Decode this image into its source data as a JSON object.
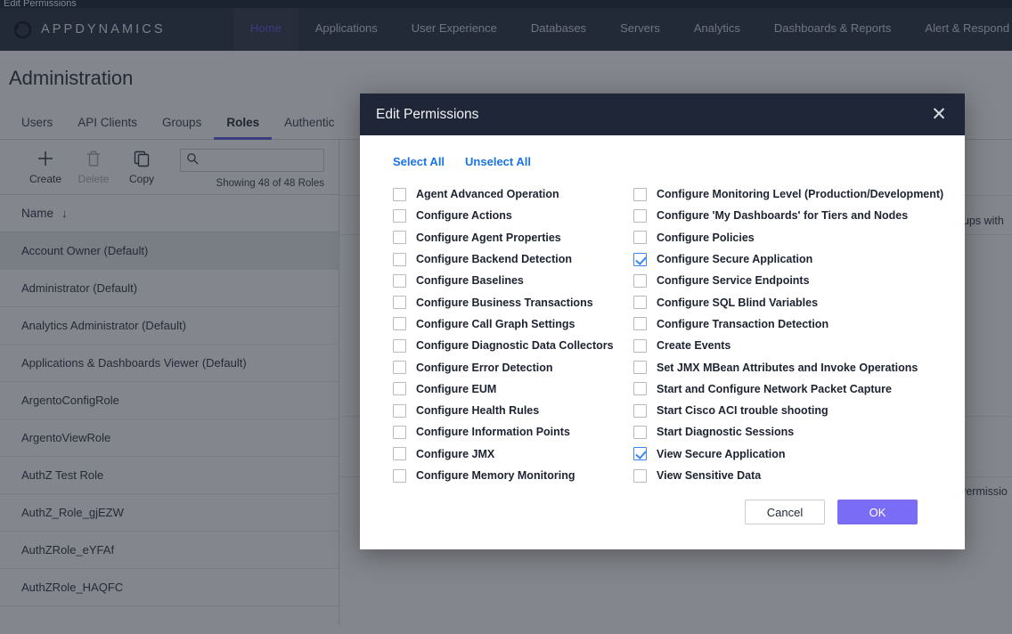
{
  "window": {
    "title": "Edit Permissions"
  },
  "topnav": {
    "brand": "APPDYNAMICS",
    "brand_icon": "appdynamics-logo-icon",
    "items": [
      {
        "label": "Home",
        "active": true
      },
      {
        "label": "Applications",
        "active": false
      },
      {
        "label": "User Experience",
        "active": false
      },
      {
        "label": "Databases",
        "active": false
      },
      {
        "label": "Servers",
        "active": false
      },
      {
        "label": "Analytics",
        "active": false
      },
      {
        "label": "Dashboards & Reports",
        "active": false
      },
      {
        "label": "Alert & Respond",
        "active": false
      }
    ]
  },
  "page": {
    "title": "Administration",
    "tabs": [
      {
        "label": "Users",
        "active": false
      },
      {
        "label": "API Clients",
        "active": false
      },
      {
        "label": "Groups",
        "active": false
      },
      {
        "label": "Roles",
        "active": true
      },
      {
        "label": "Authentic",
        "active": false
      }
    ]
  },
  "toolbar": {
    "create_label": "Create",
    "create_icon": "plus-icon",
    "delete_label": "Delete",
    "delete_icon": "trash-icon",
    "copy_label": "Copy",
    "copy_icon": "copy-icon",
    "search_icon": "search-icon",
    "search_value": "",
    "search_placeholder": "",
    "showing_text": "Showing 48 of 48 Roles"
  },
  "roles_list": {
    "column_header": "Name",
    "sort_icon": "arrow-down-icon",
    "rows": [
      {
        "name": "Account Owner (Default)",
        "selected": true
      },
      {
        "name": "Administrator (Default)",
        "selected": false
      },
      {
        "name": "Analytics Administrator (Default)",
        "selected": false
      },
      {
        "name": "Applications & Dashboards Viewer (Default)",
        "selected": false
      },
      {
        "name": "ArgentoConfigRole",
        "selected": false
      },
      {
        "name": "ArgentoViewRole",
        "selected": false
      },
      {
        "name": "AuthZ Test Role",
        "selected": false
      },
      {
        "name": "AuthZ_Role_gjEZW",
        "selected": false
      },
      {
        "name": "AuthZRole_eYFAf",
        "selected": false
      },
      {
        "name": "AuthZRole_HAQFC",
        "selected": false
      }
    ]
  },
  "detail_pane": {
    "groups_text": "oups with",
    "permissions_text": "Permissio"
  },
  "modal": {
    "title": "Edit Permissions",
    "close_icon": "close-icon",
    "select_all_label": "Select All",
    "unselect_all_label": "Unselect All",
    "permissions_left": [
      {
        "label": "Agent Advanced Operation",
        "checked": false
      },
      {
        "label": "Configure Actions",
        "checked": false
      },
      {
        "label": "Configure Agent Properties",
        "checked": false
      },
      {
        "label": "Configure Backend Detection",
        "checked": false
      },
      {
        "label": "Configure Baselines",
        "checked": false
      },
      {
        "label": "Configure Business Transactions",
        "checked": false
      },
      {
        "label": "Configure Call Graph Settings",
        "checked": false
      },
      {
        "label": "Configure Diagnostic Data Collectors",
        "checked": false
      },
      {
        "label": "Configure Error Detection",
        "checked": false
      },
      {
        "label": "Configure EUM",
        "checked": false
      },
      {
        "label": "Configure Health Rules",
        "checked": false
      },
      {
        "label": "Configure Information Points",
        "checked": false
      },
      {
        "label": "Configure JMX",
        "checked": false
      },
      {
        "label": "Configure Memory Monitoring",
        "checked": false
      }
    ],
    "permissions_right": [
      {
        "label": "Configure Monitoring Level (Production/Development)",
        "checked": false
      },
      {
        "label": "Configure 'My Dashboards' for Tiers and Nodes",
        "checked": false
      },
      {
        "label": "Configure Policies",
        "checked": false
      },
      {
        "label": "Configure Secure Application",
        "checked": true
      },
      {
        "label": "Configure Service Endpoints",
        "checked": false
      },
      {
        "label": "Configure SQL Blind Variables",
        "checked": false
      },
      {
        "label": "Configure Transaction Detection",
        "checked": false
      },
      {
        "label": "Create Events",
        "checked": false
      },
      {
        "label": "Set JMX MBean Attributes and Invoke Operations",
        "checked": false
      },
      {
        "label": "Start and Configure Network Packet Capture",
        "checked": false
      },
      {
        "label": "Start Cisco ACI trouble shooting",
        "checked": false
      },
      {
        "label": "Start Diagnostic Sessions",
        "checked": false
      },
      {
        "label": "View Secure Application",
        "checked": true
      },
      {
        "label": "View Sensitive Data",
        "checked": false
      }
    ],
    "cancel_label": "Cancel",
    "ok_label": "OK"
  },
  "colors": {
    "nav_bg": "#2b3344",
    "nav_active": "#5d5ce0",
    "modal_header_bg": "#1e2637",
    "link_blue": "#1a73e8",
    "checkbox_blue": "#3b86f0",
    "ok_button": "#7b6cf6",
    "tab_underline": "#5d5ce0"
  }
}
